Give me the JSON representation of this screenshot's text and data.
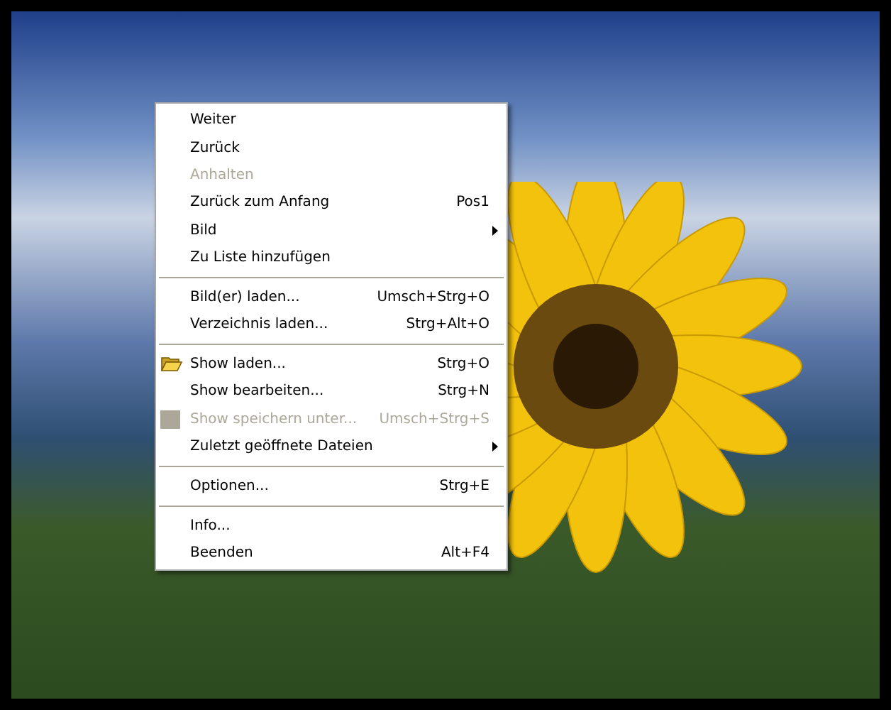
{
  "menu": [
    {
      "kind": "item",
      "label": "Weiter",
      "disabled": false
    },
    {
      "kind": "item",
      "label": "Zurück",
      "disabled": false
    },
    {
      "kind": "item",
      "label": "Anhalten",
      "disabled": true
    },
    {
      "kind": "item",
      "label": "Zurück zum Anfang",
      "shortcut": "Pos1",
      "disabled": false
    },
    {
      "kind": "item",
      "label": "Bild",
      "submenu": true,
      "disabled": false
    },
    {
      "kind": "item",
      "label": "Zu Liste hinzufügen",
      "disabled": false
    },
    {
      "kind": "separator"
    },
    {
      "kind": "item",
      "label": "Bild(er) laden...",
      "shortcut": "Umsch+Strg+O",
      "disabled": false
    },
    {
      "kind": "item",
      "label": "Verzeichnis laden...",
      "shortcut": "Strg+Alt+O",
      "disabled": false
    },
    {
      "kind": "separator"
    },
    {
      "kind": "folder",
      "label": "Show laden...",
      "shortcut": "Strg+O",
      "disabled": false
    },
    {
      "kind": "item",
      "label": "Show bearbeiten...",
      "shortcut": "Strg+N",
      "disabled": false
    },
    {
      "kind": "square",
      "label": "Show speichern unter...",
      "shortcut": "Umsch+Strg+S",
      "disabled": true
    },
    {
      "kind": "item",
      "label": "Zuletzt geöffnete Dateien",
      "submenu": true,
      "disabled": false
    },
    {
      "kind": "separator"
    },
    {
      "kind": "item",
      "label": "Optionen...",
      "shortcut": "Strg+E",
      "disabled": false
    },
    {
      "kind": "separator"
    },
    {
      "kind": "item",
      "label": "Info...",
      "disabled": false
    },
    {
      "kind": "item",
      "label": "Beenden",
      "shortcut": "Alt+F4",
      "disabled": false
    }
  ]
}
